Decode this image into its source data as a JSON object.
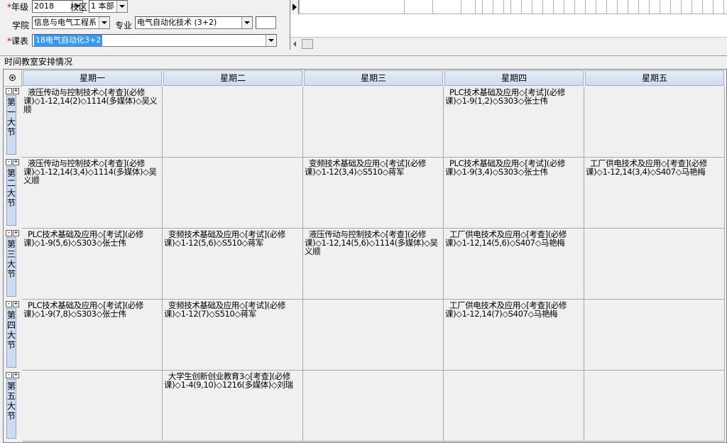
{
  "filters": {
    "required_mark": "*",
    "grade_label": "年级",
    "grade_value": "2018",
    "campus_label": "校区",
    "campus_value": "1 本部",
    "college_label": "学院",
    "college_value": "信息与电气工程系",
    "major_label": "专业",
    "major_value": "电气自动化技术 (3+2)",
    "extra_value": "",
    "schedule_label": "课表",
    "schedule_value": "18电气自动化3+2"
  },
  "section_title": "时间教室安排情况",
  "days": [
    "星期一",
    "星期二",
    "星期三",
    "星期四",
    "星期五"
  ],
  "periods": [
    "第一大节",
    "第二大节",
    "第三大节",
    "第四大节",
    "第五大节"
  ],
  "expand_symbols": {
    "minus": "-",
    "plus": "+"
  },
  "cells": [
    [
      "液压传动与控制技术◇[考查](必修课)◇1-12,14(2)◇1114(多媒体)◇吴义顺",
      "",
      "",
      "PLC技术基础及应用◇[考试](必修课)◇1-9(1,2)◇S303◇张士伟",
      ""
    ],
    [
      "液压传动与控制技术◇[考查](必修课)◇1-12,14(3,4)◇1114(多媒体)◇吴义顺",
      "",
      "变频技术基础及应用◇[考试](必修课)◇1-12(3,4)◇S510◇蒋军",
      "PLC技术基础及应用◇[考试](必修课)◇1-9(3,4)◇S303◇张士伟",
      "工厂供电技术及应用◇[考查](必修课)◇1-12,14(3,4)◇S407◇马艳梅"
    ],
    [
      "PLC技术基础及应用◇[考试](必修课)◇1-9(5,6)◇S303◇张士伟",
      "变频技术基础及应用◇[考试](必修课)◇1-12(5,6)◇S510◇蒋军",
      "液压传动与控制技术◇[考查](必修课)◇1-12,14(5,6)◇1114(多媒体)◇吴义顺",
      "工厂供电技术及应用◇[考查](必修课)◇1-12,14(5,6)◇S407◇马艳梅",
      ""
    ],
    [
      "PLC技术基础及应用◇[考试](必修课)◇1-9(7,8)◇S303◇张士伟",
      "变频技术基础及应用◇[考试](必修课)◇1-12(7)◇S510◇蒋军",
      "",
      "工厂供电技术及应用◇[考查](必修课)◇1-12,14(7)◇S407◇马艳梅",
      ""
    ],
    [
      "",
      "大学生创新创业教育3◇[考查](必修课)◇1-4(9,10)◇1216(多媒体)◇刘瑞",
      "",
      "",
      ""
    ]
  ]
}
